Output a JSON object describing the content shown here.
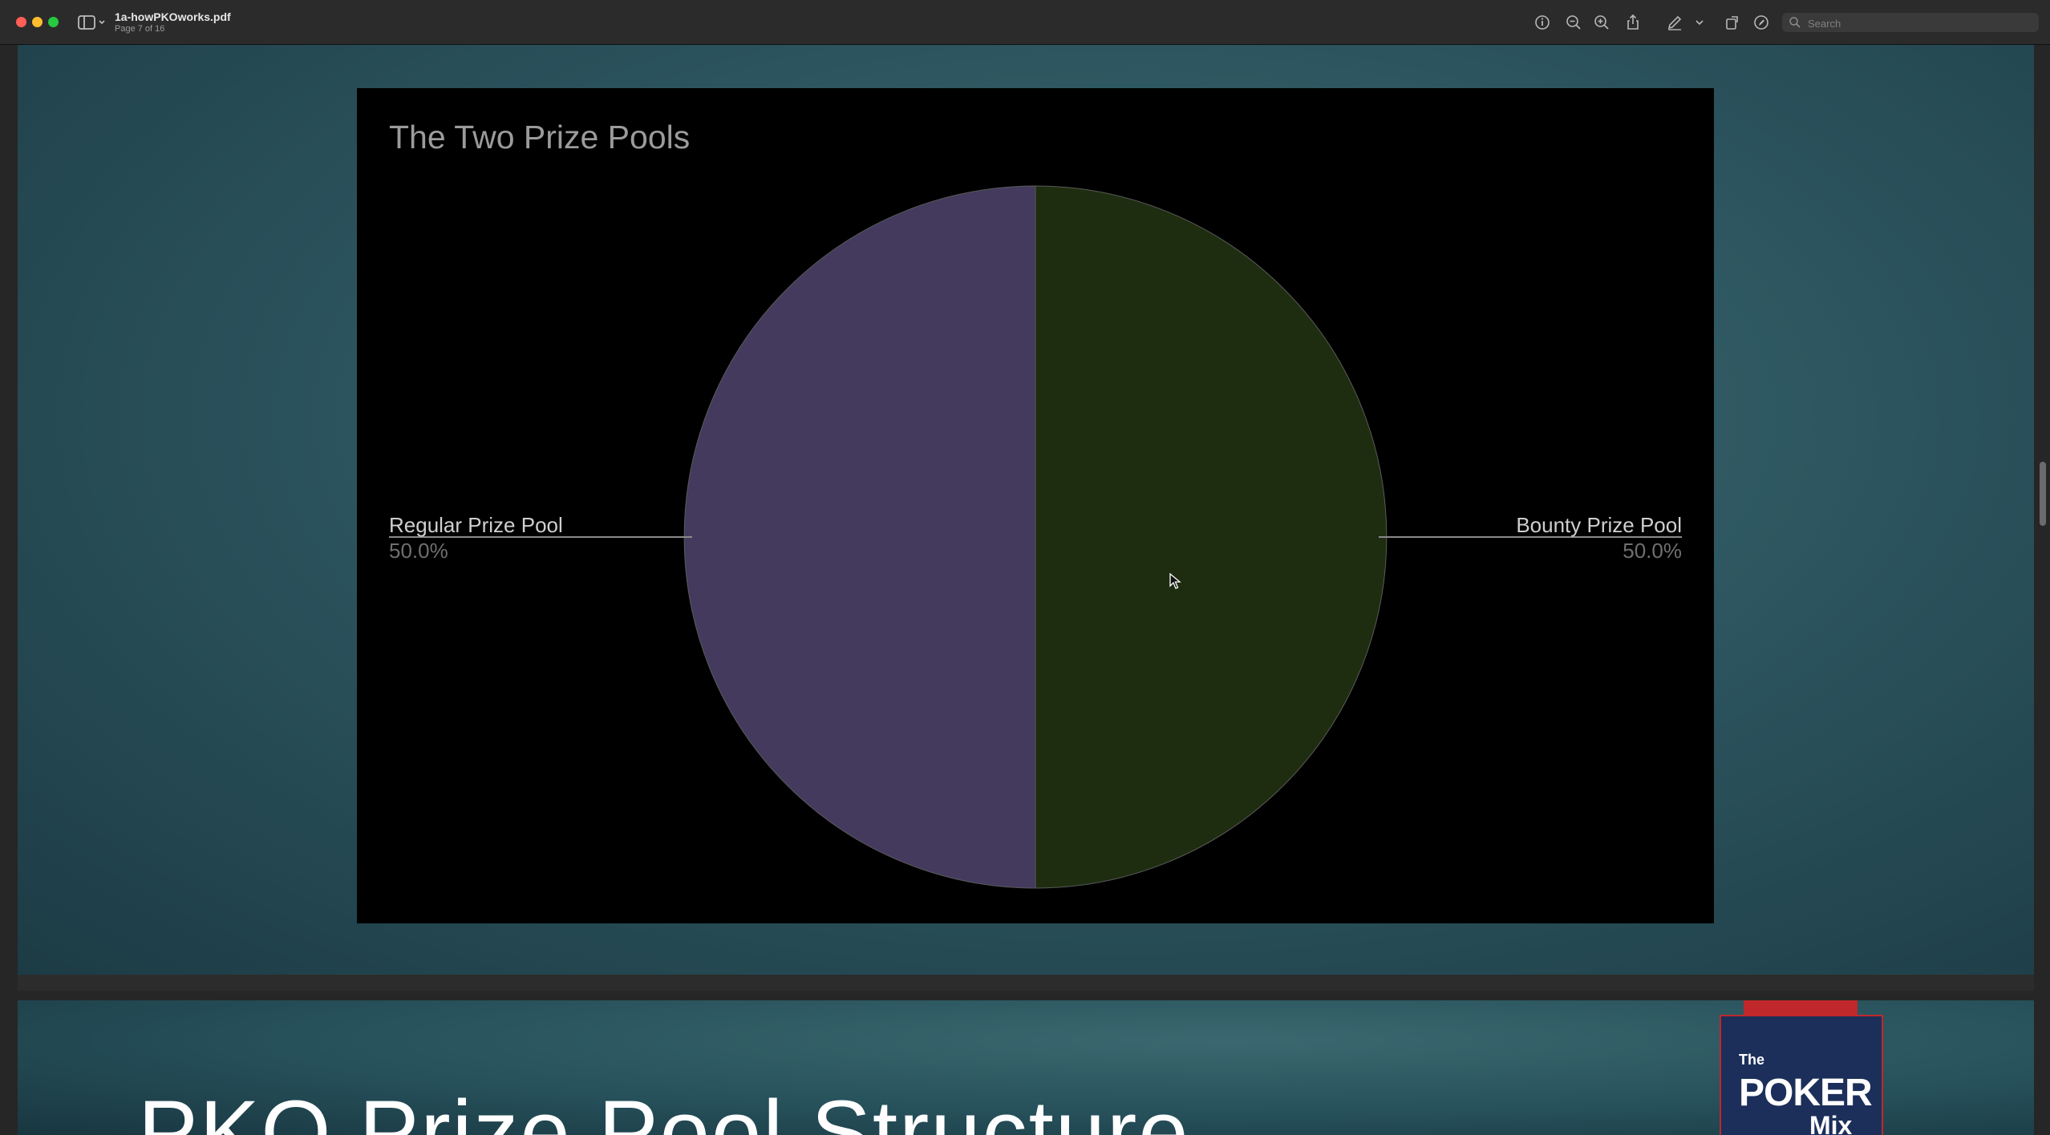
{
  "window": {
    "filename": "1a-howPKOworks.pdf",
    "page_indicator": "Page 7 of 16"
  },
  "toolbar": {
    "icons": [
      "info-icon",
      "zoom-out-icon",
      "zoom-in-icon",
      "share-icon",
      "markup-pen-icon",
      "chevron-down-icon",
      "rotate-icon",
      "annotate-icon"
    ],
    "search_placeholder": "Search"
  },
  "slide": {
    "chart_data": {
      "type": "pie",
      "title": "The Two Prize Pools",
      "slices": [
        {
          "label": "Regular Prize Pool",
          "value": 50.0,
          "percent_label": "50.0%",
          "color": "#433a5e"
        },
        {
          "label": "Bounty Prize Pool",
          "value": 50.0,
          "percent_label": "50.0%",
          "color": "#1e2d10"
        }
      ]
    }
  },
  "next_page": {
    "title": "PKO Prize Pool Structure",
    "logo": {
      "line1": "The",
      "line2": "POKER",
      "line3": "Mix"
    },
    "colors": {
      "logo_red": "#c0282b",
      "logo_navy": "#1c2f5a"
    }
  }
}
